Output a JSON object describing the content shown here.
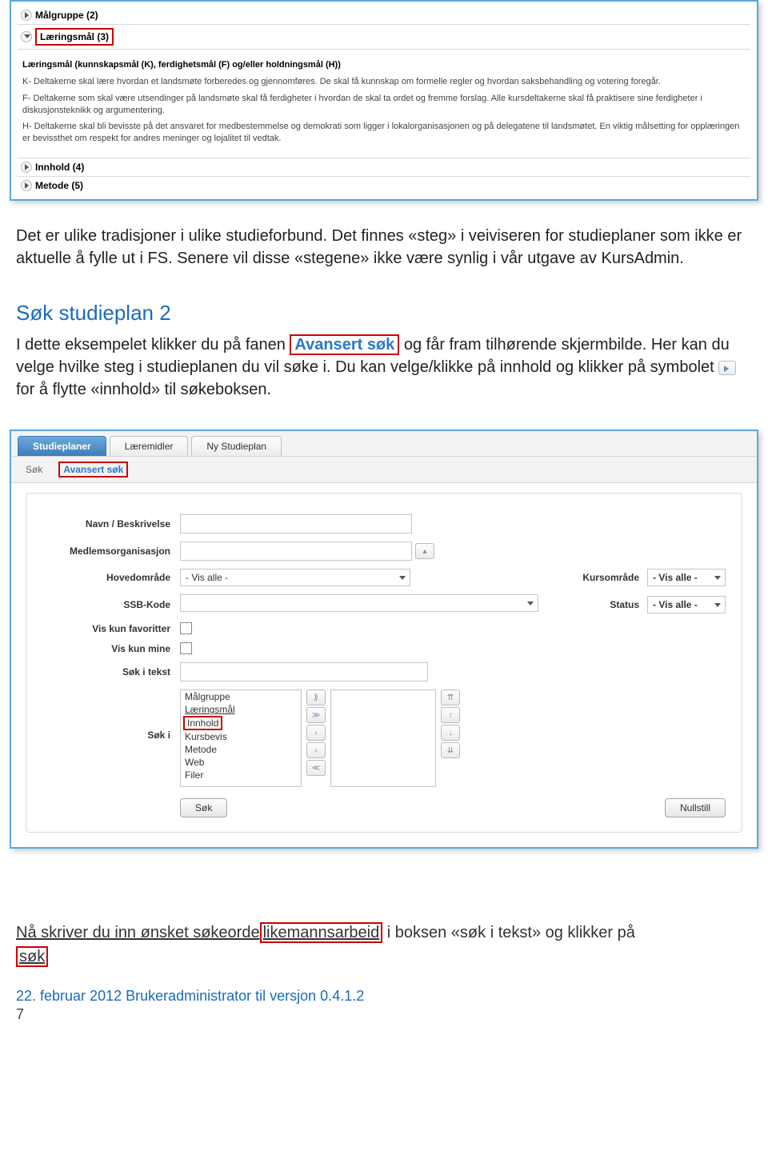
{
  "top_panel": {
    "rows": [
      {
        "label": "Målgruppe (2)",
        "expanded": false,
        "highlighted": false
      },
      {
        "label": "Læringsmål (3)",
        "expanded": true,
        "highlighted": true
      }
    ],
    "content_title": "Læringsmål (kunnskapsmål (K), ferdighetsmål (F) og/eller holdningsmål (H))",
    "content_k": "K- Deltakerne skal lære hvordan et landsmøte forberedes og gjennomføres. De skal få kunnskap om formelle regler og hvordan saksbehandling og votering foregår.",
    "content_f": "F- Deltakerne som skal være utsendinger på landsmøte skal få ferdigheter i hvordan de skal ta ordet og fremme forslag. Alle kursdeltakerne skal få praktisere sine ferdigheter i diskusjonsteknikk og argumentering.",
    "content_h": "H- Deltakerne skal bli bevisste på det ansvaret for medbestemmelse og demokrati som ligger i lokalorganisasjonen og på delegatene til landsmøtet. En viktig målsetting for opplæringen er bevissthet om respekt for andres meninger og lojalitet til vedtak.",
    "rows_after": [
      {
        "label": "Innhold (4)"
      },
      {
        "label": "Metode (5)"
      }
    ]
  },
  "para1": "Det er ulike tradisjoner i ulike studieforbund. Det finnes «steg» i veiviseren for studieplaner som ikke er aktuelle å fylle ut i FS. Senere vil disse «stegene» ikke være synlig i vår utgave av KursAdmin.",
  "section2": {
    "heading": "Søk studieplan 2",
    "text_before": "I dette eksempelet klikker du på fanen ",
    "link": "Avansert søk",
    "text_mid1": " og får fram tilhørende skjermbilde. Her kan du velge hvilke steg i studieplanen du vil søke i. Du kan velge/klikke på innhold og klikker på symbolet ",
    "text_after": " for å flytte «innhold» til søkeboksen."
  },
  "search_panel": {
    "tabs": [
      "Studieplaner",
      "Læremidler",
      "Ny Studieplan"
    ],
    "subtabs": [
      "Søk",
      "Avansert søk"
    ],
    "labels": {
      "name_desc": "Navn / Beskrivelse",
      "member_org": "Medlemsorganisasjon",
      "hovedomrade": "Hovedområde",
      "ssb": "SSB-Kode",
      "kursomrade": "Kursområde",
      "status": "Status",
      "kun_fav": "Vis kun favoritter",
      "kun_mine": "Vis kun mine",
      "sok_tekst": "Søk i tekst",
      "sok_i": "Søk i"
    },
    "vis_alle": "- Vis alle -",
    "list_items": [
      "Målgruppe",
      "Læringsmål",
      "Innhold",
      "Kursbevis",
      "Metode",
      "Web",
      "Filer"
    ],
    "btn_sok": "Søk",
    "btn_nullstill": "Nullstill"
  },
  "bottom": {
    "text_before": "Nå skriver du inn ønsket søkeorde",
    "highlight": "likemannsarbeid",
    "text_mid": " i boksen «søk i tekst» og klikker på ",
    "sok": "søk"
  },
  "footer": "22. februar 2012 Brukeradministrator til versjon 0.4.1.2",
  "pagenum": "7"
}
